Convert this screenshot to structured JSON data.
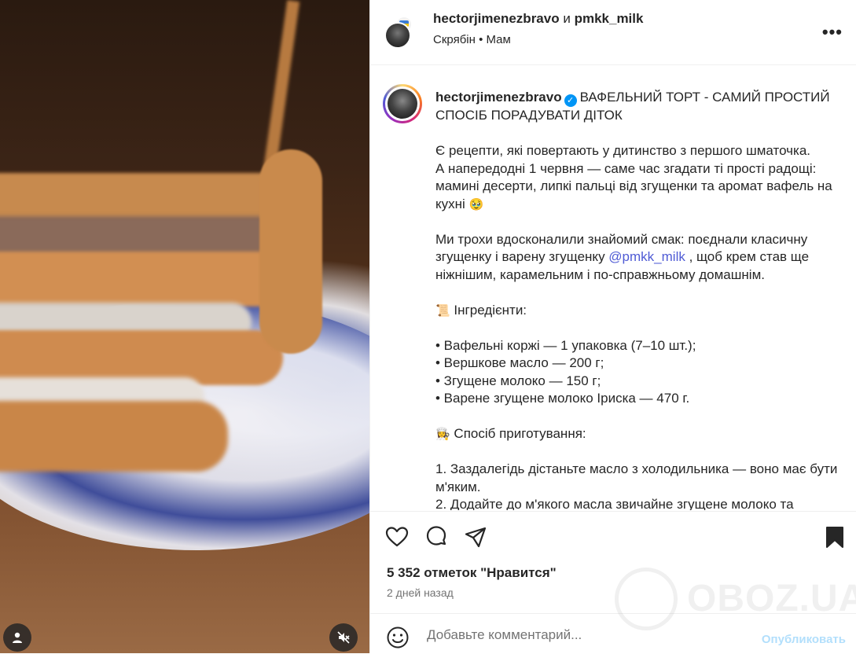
{
  "header": {
    "user1": "hectorjimenezbravo",
    "and": "и",
    "user2": "pmkk_milk",
    "audio_artist": "Скрябін",
    "audio_sep": "•",
    "audio_title": "Мам"
  },
  "caption": {
    "username": "hectorjimenezbravo",
    "title": "ВАФЕЛЬНИЙ ТОРТ - САМИЙ ПРОСТИЙ СПОСІБ ПОРАДУВАТИ ДІТОК",
    "p1_l1": "Є рецепти, які повертають у дитинство з першого шматочка.",
    "p1_l2": "А напередодні 1 червня — саме час згадати ті прості радощі: мамині десерти, липкі пальці від згущенки та аромат вафель на кухні",
    "p1_emoji": "🥹",
    "p2_a": "Ми трохи вдосконалили знайомий смак: поєднали класичну згущенку і варену згущенку ",
    "p2_mention": "@pmkk_milk",
    "p2_b": " , щоб крем став ще ніжнішим, карамельним і по-справжньому домашнім.",
    "ingredients_emoji": "📜",
    "ingredients_title": "Інгредієнти:",
    "ingredients": [
      "• Вафельні коржі — 1 упаковка (7–10 шт.);",
      "• Вершкове масло — 200 г;",
      "• Згущене молоко — 150 г;",
      "• Варене згущене молоко Іриска — 470 г."
    ],
    "method_emoji": "👩‍🍳",
    "method_title": "Спосіб приготування:",
    "steps": [
      "1. Заздалегідь дістаньте масло з холодильника — воно має бути м'яким.",
      "2. Додайте до м'якого масла звичайне згущене молоко та"
    ]
  },
  "actions": {
    "likes": "5 352 отметок \"Нравится\"",
    "time": "2 дней назад"
  },
  "comment": {
    "placeholder": "Добавьте комментарий...",
    "publish": "Опубликовать"
  },
  "watermark": "OBOZ.UA",
  "colors": {
    "link": "#4f5bd5",
    "verified": "#0095f6",
    "publish": "#b2dffc"
  }
}
